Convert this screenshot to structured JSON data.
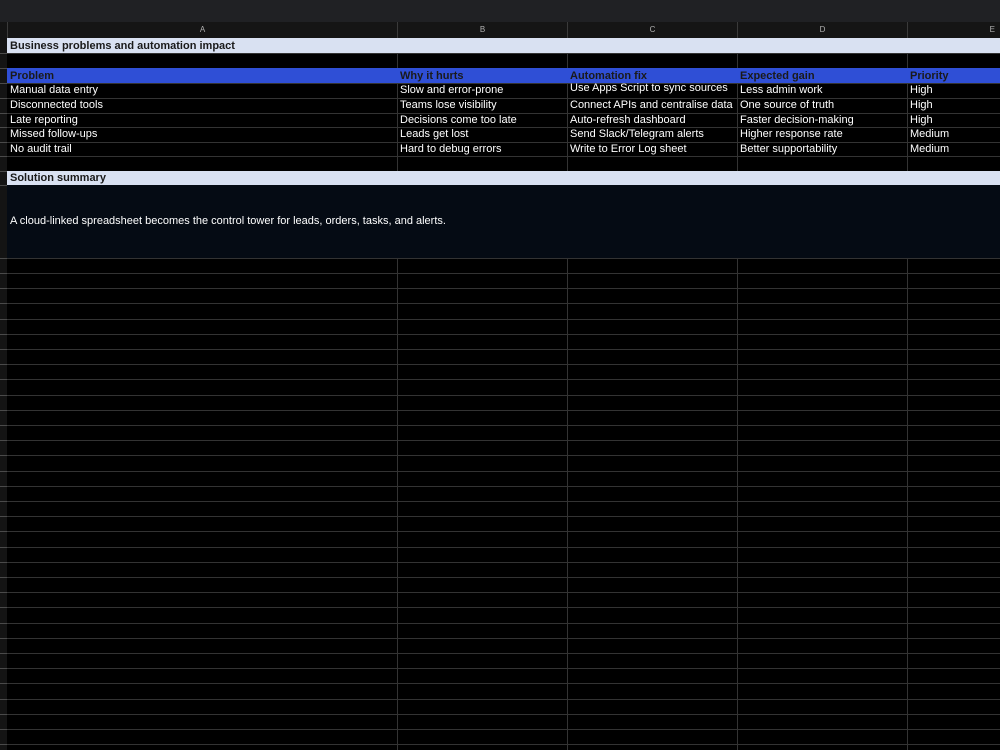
{
  "columns": [
    "A",
    "B",
    "C",
    "D",
    "E"
  ],
  "section_title": "Business problems and automation impact",
  "table": {
    "headers": [
      "Problem",
      "Why it hurts",
      "Automation fix",
      "Expected gain",
      "Priority"
    ],
    "rows": [
      [
        "Manual data entry",
        "Slow and error-prone",
        "Use Apps Script to sync sources",
        "Less admin work",
        "High"
      ],
      [
        "Disconnected tools",
        "Teams lose visibility",
        "Connect APIs and centralise data",
        "One source of truth",
        "High"
      ],
      [
        "Late reporting",
        "Decisions come too late",
        "Auto-refresh dashboard",
        "Faster decision-making",
        "High"
      ],
      [
        "Missed follow-ups",
        "Leads get lost",
        "Send Slack/Telegram alerts",
        "Higher response rate",
        "Medium"
      ],
      [
        "No audit trail",
        "Hard to debug errors",
        "Write to Error Log sheet",
        "Better supportability",
        "Medium"
      ]
    ]
  },
  "summary_title": "Solution summary",
  "summary_text": "A cloud-linked spreadsheet becomes the control tower for leads, orders, tasks, and alerts.",
  "colors": {
    "title_band": "#d9e1f2",
    "header_band": "#2f4fd6",
    "summary_band": "#050b14",
    "grid_line": "#333333"
  }
}
